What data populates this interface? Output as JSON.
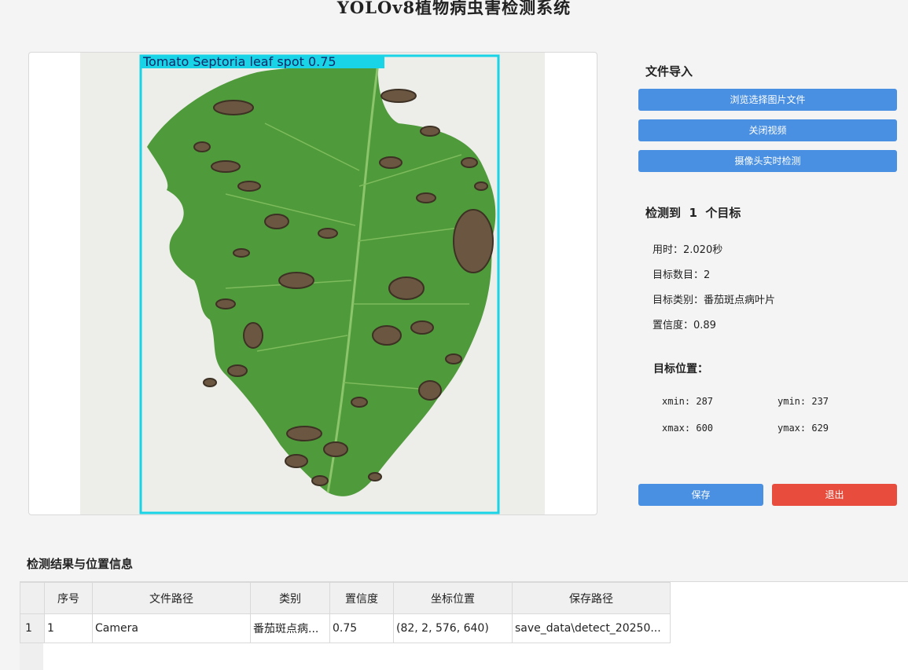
{
  "window": {
    "title": "YOLOv8植物病虫害检测系统"
  },
  "image_panel": {
    "detection_label": "Tomato Septoria leaf spot 0.75"
  },
  "file_import": {
    "heading": "文件导入",
    "browse_button": "浏览选择图片文件",
    "close_video_button": "关闭视频",
    "camera_button": "摄像头实时检测"
  },
  "detection": {
    "heading": "检测到  1  个目标",
    "time_label": "用时：2.020秒",
    "count_label": "目标数目：2",
    "class_label": "目标类别：番茄斑点病叶片",
    "confidence_label": "置信度：0.89"
  },
  "position": {
    "heading": "目标位置：",
    "xmin": "xmin: 287",
    "ymin": "ymin: 237",
    "xmax": "xmax: 600",
    "ymax": "ymax: 629"
  },
  "actions": {
    "save_button": "保存",
    "exit_button": "退出"
  },
  "results": {
    "heading": "检测结果与位置信息",
    "columns": [
      "序号",
      "文件路径",
      "类别",
      "置信度",
      "坐标位置",
      "保存路径"
    ],
    "rows": [
      {
        "row_number": "1",
        "index": "1",
        "file_path": "Camera",
        "category": "番茄斑点病...",
        "confidence": "0.75",
        "coords": "(82, 2, 576, 640)",
        "save_path": "save_data\\detect_20250..."
      }
    ]
  },
  "colors": {
    "primary_button": "#4a90e2",
    "danger_button": "#e74c3c",
    "detection_box": "#18d4e6"
  }
}
